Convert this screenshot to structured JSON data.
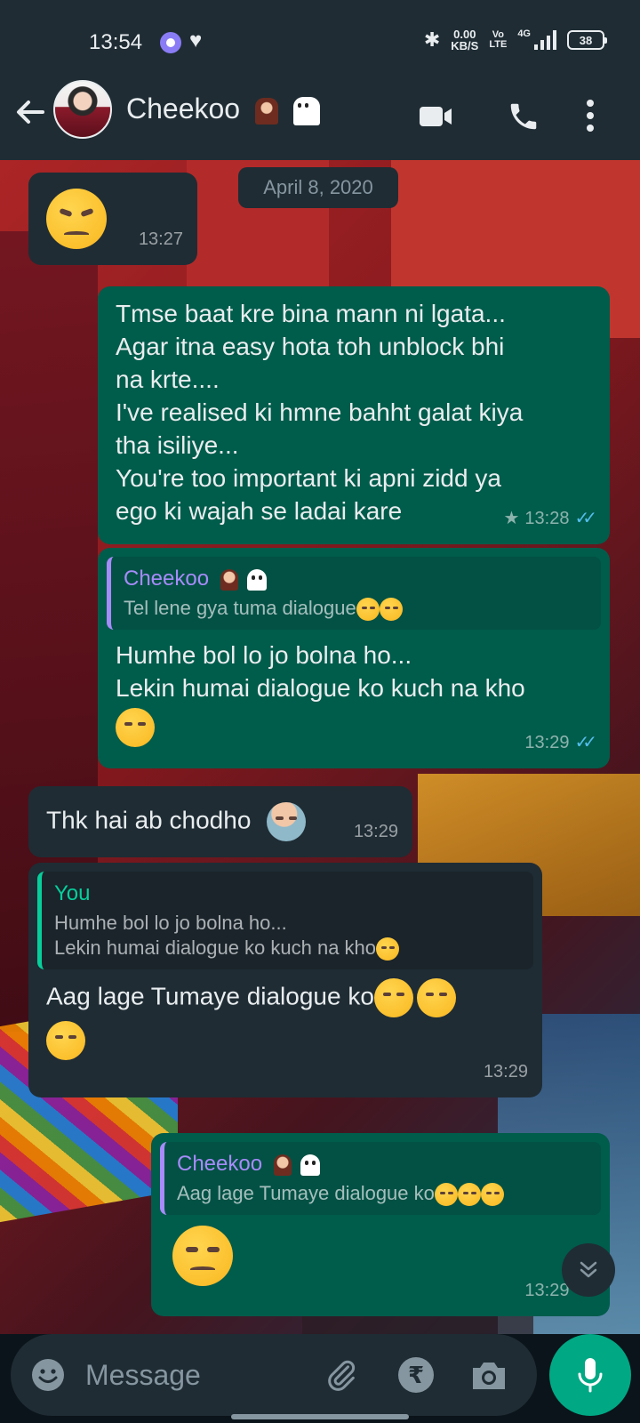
{
  "status_bar": {
    "time": "13:54",
    "net_speed_value": "0.00",
    "net_speed_unit": "KB/S",
    "volte_top": "Vo",
    "volte_bottom": "LTE",
    "network": "4G",
    "battery": "38"
  },
  "header": {
    "contact_name": "Cheekoo",
    "icons": [
      "back-arrow-icon",
      "video-call-icon",
      "voice-call-icon",
      "more-options-icon"
    ]
  },
  "chat": {
    "date_label": "April 8, 2020",
    "messages": [
      {
        "time": "13:27"
      },
      {
        "lines": [
          "Tmse baat kre bina mann ni lgata...",
          "Agar itna easy hota toh unblock bhi",
          "na krte....",
          "I've realised ki hmne bahht galat kiya",
          "tha isiliye...",
          "You're too important ki apni zidd ya",
          "ego ki wajah se ladai kare"
        ],
        "time": "13:28"
      },
      {
        "quote_name": "Cheekoo",
        "quote_text": "Tel lene gya tuma dialogue",
        "lines": [
          "Humhe bol lo jo bolna ho...",
          "Lekin humai dialogue ko kuch na kho"
        ],
        "time": "13:29"
      },
      {
        "text": "Thk hai ab chodho",
        "time": "13:29"
      },
      {
        "quote_name": "You",
        "quote_line1": "Humhe bol lo jo bolna ho...",
        "quote_line2": "Lekin humai dialogue ko kuch na kho",
        "text": "Aag lage Tumaye dialogue ko",
        "time": "13:29"
      },
      {
        "quote_name": "Cheekoo",
        "quote_text": "Aag lage Tumaye dialogue ko",
        "time": "13:29"
      }
    ]
  },
  "input": {
    "placeholder": "Message"
  },
  "colors": {
    "incoming_bubble": "#1f2c34",
    "outgoing_bubble": "#005c4b",
    "read_ticks": "#53bdeb",
    "accent": "#00a884",
    "quote_name_cheekoo": "#a78bfa",
    "quote_name_you": "#06cf9c"
  }
}
